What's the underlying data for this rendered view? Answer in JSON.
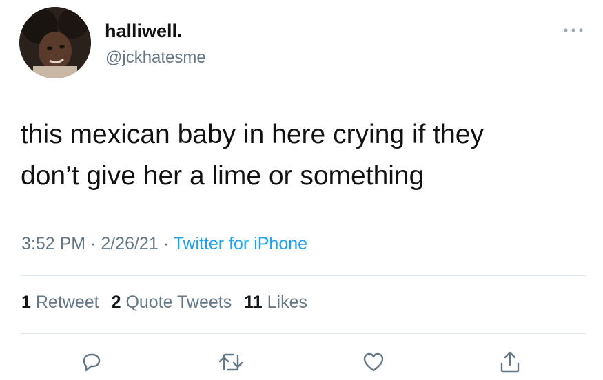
{
  "user": {
    "display_name": "halliwell.",
    "handle": "@jckhatesme",
    "avatar_icon": "profile-photo"
  },
  "more_icon": "more-dots-icon",
  "tweet": {
    "text_line1": "this mexican baby in here crying if they",
    "text_line2": "don’t give her a lime or something"
  },
  "meta": {
    "time": "3:52 PM",
    "sep1": " · ",
    "date": "2/26/21",
    "sep2": " · ",
    "source": "Twitter for iPhone"
  },
  "stats": {
    "retweets_count": "1",
    "retweets_label": "Retweet",
    "quotes_count": "2",
    "quotes_label": "Quote Tweets",
    "likes_count": "11",
    "likes_label": "Likes"
  },
  "actions": [
    "reply-icon",
    "retweet-icon",
    "like-icon",
    "share-icon"
  ],
  "colors": {
    "accent": "#1da1f2",
    "secondary_text": "#657786",
    "icon": "#657786",
    "divider": "#e1e8ed"
  }
}
